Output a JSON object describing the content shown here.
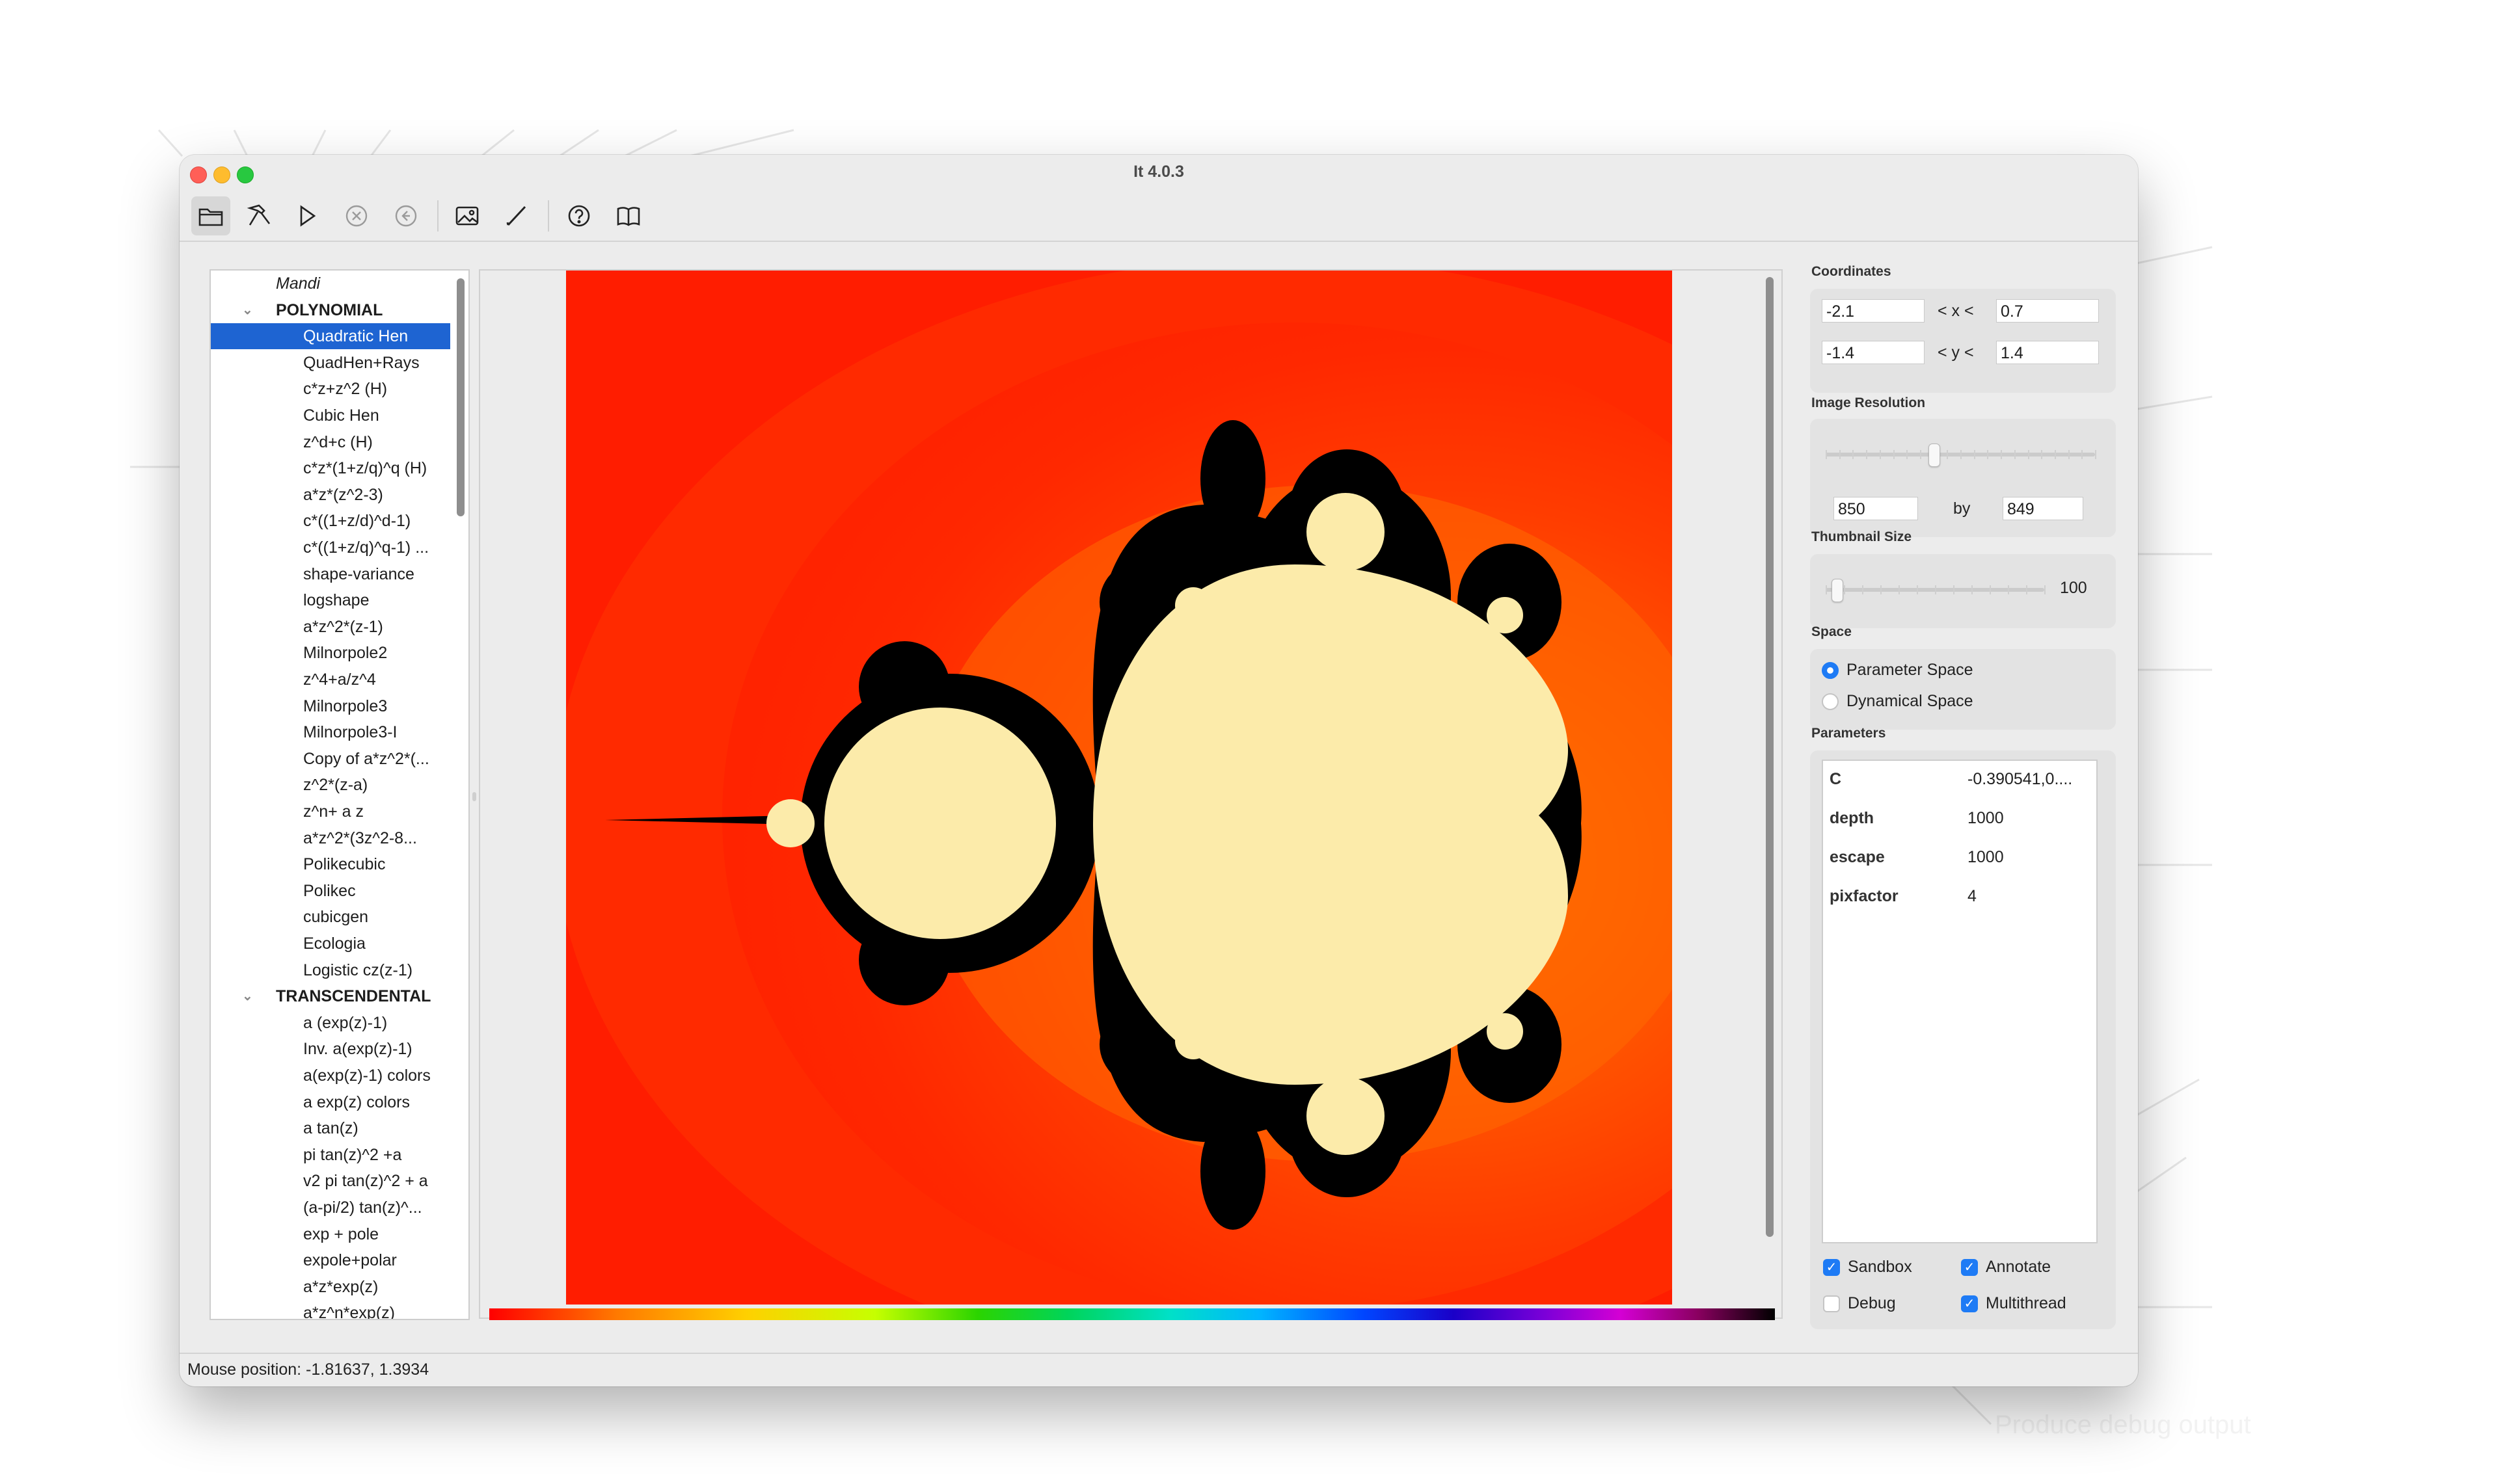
{
  "window": {
    "title": "It 4.0.3"
  },
  "toolbar": {
    "icons": [
      "folder-open-icon",
      "hammer-icon",
      "play-icon",
      "stop-circle-icon",
      "back-circle-icon",
      "image-icon",
      "pen-icon",
      "help-icon",
      "book-icon"
    ]
  },
  "sidebar": {
    "rows": [
      {
        "label": "Mandi",
        "kind": "root"
      },
      {
        "label": "POLYNOMIAL",
        "kind": "group"
      },
      {
        "label": "Quadratic Hen",
        "kind": "item",
        "selected": true
      },
      {
        "label": "QuadHen+Rays",
        "kind": "item"
      },
      {
        "label": "c*z+z^2 (H)",
        "kind": "item"
      },
      {
        "label": "Cubic Hen",
        "kind": "item"
      },
      {
        "label": "z^d+c (H)",
        "kind": "item"
      },
      {
        "label": "c*z*(1+z/q)^q (H)",
        "kind": "item"
      },
      {
        "label": "a*z*(z^2-3)",
        "kind": "item"
      },
      {
        "label": "c*((1+z/d)^d-1)",
        "kind": "item"
      },
      {
        "label": "c*((1+z/q)^q-1) ...",
        "kind": "item"
      },
      {
        "label": "shape-variance",
        "kind": "item"
      },
      {
        "label": "logshape",
        "kind": "item"
      },
      {
        "label": "a*z^2*(z-1)",
        "kind": "item"
      },
      {
        "label": "Milnorpole2",
        "kind": "item"
      },
      {
        "label": "z^4+a/z^4",
        "kind": "item"
      },
      {
        "label": "Milnorpole3",
        "kind": "item"
      },
      {
        "label": "Milnorpole3-I",
        "kind": "item"
      },
      {
        "label": "Copy of a*z^2*(...",
        "kind": "item"
      },
      {
        "label": "z^2*(z-a)",
        "kind": "item"
      },
      {
        "label": "z^n+ a z",
        "kind": "item"
      },
      {
        "label": "a*z^2*(3z^2-8...",
        "kind": "item"
      },
      {
        "label": "Polikecubic",
        "kind": "item"
      },
      {
        "label": "Polikec",
        "kind": "item"
      },
      {
        "label": "cubicgen",
        "kind": "item"
      },
      {
        "label": "Ecologia",
        "kind": "item"
      },
      {
        "label": "Logistic cz(z-1)",
        "kind": "item"
      },
      {
        "label": "TRANSCENDENTAL",
        "kind": "group"
      },
      {
        "label": "a (exp(z)-1)",
        "kind": "item"
      },
      {
        "label": "Inv. a(exp(z)-1)",
        "kind": "item"
      },
      {
        "label": "a(exp(z)-1) colors",
        "kind": "item"
      },
      {
        "label": "a exp(z) colors",
        "kind": "item"
      },
      {
        "label": "a tan(z)",
        "kind": "item"
      },
      {
        "label": "pi tan(z)^2 +a",
        "kind": "item"
      },
      {
        "label": "v2 pi tan(z)^2 + a",
        "kind": "item"
      },
      {
        "label": "(a-pi/2) tan(z)^...",
        "kind": "item"
      },
      {
        "label": "exp + pole",
        "kind": "item"
      },
      {
        "label": "expole+polar",
        "kind": "item"
      },
      {
        "label": "a*z*exp(z)",
        "kind": "item"
      },
      {
        "label": "a*z^n*exp(z)",
        "kind": "item"
      }
    ]
  },
  "coordinates": {
    "label": "Coordinates",
    "x_min": "-2.1",
    "x_max": "0.7",
    "x_sep": "< x <",
    "y_min": "-1.4",
    "y_max": "1.4",
    "y_sep": "< y <"
  },
  "resolution": {
    "label": "Image Resolution",
    "width": "850",
    "height": "849",
    "by": "by",
    "slider_fraction": 0.4
  },
  "thumbnail": {
    "label": "Thumbnail Size",
    "value": "100",
    "slider_fraction": 0.05
  },
  "space": {
    "label": "Space",
    "options": [
      {
        "label": "Parameter Space",
        "selected": true
      },
      {
        "label": "Dynamical Space",
        "selected": false
      }
    ]
  },
  "parameters": {
    "label": "Parameters",
    "rows": [
      {
        "key": "C",
        "value": "-0.390541,0...."
      },
      {
        "key": "depth",
        "value": "1000"
      },
      {
        "key": "escape",
        "value": "1000"
      },
      {
        "key": "pixfactor",
        "value": "4"
      }
    ]
  },
  "options": {
    "sandbox": {
      "label": "Sandbox",
      "checked": true
    },
    "annotate": {
      "label": "Annotate",
      "checked": true
    },
    "debug": {
      "label": "Debug",
      "checked": false
    },
    "multithread": {
      "label": "Multithread",
      "checked": true
    }
  },
  "status": {
    "text": "Mouse position: -1.81637, 1.3934"
  },
  "annotation_text": "Produce debug output",
  "colors": {
    "selection": "#1e64d2",
    "accent": "#1e7bf5",
    "set_fill": "#fcebaa",
    "background_red": "#ff1d00"
  }
}
